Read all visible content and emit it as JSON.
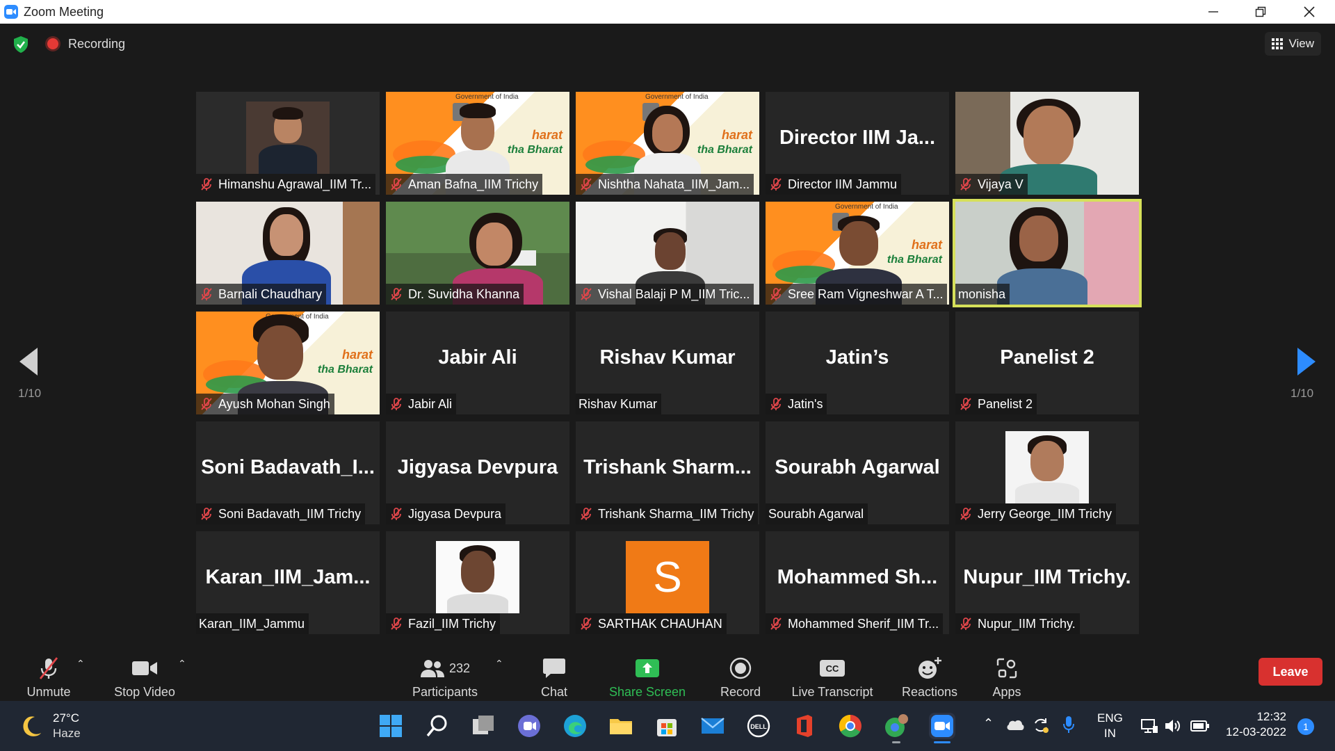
{
  "window": {
    "title": "Zoom Meeting"
  },
  "topbar": {
    "recording_label": "Recording",
    "view_label": "View"
  },
  "pagination": {
    "left": "1/10",
    "right": "1/10"
  },
  "tiles": [
    {
      "label": "Himanshu Agrawal_IIM Tr...",
      "big": "",
      "muted": true
    },
    {
      "label": "Aman Bafna_IIM Trichy",
      "big": "",
      "muted": true
    },
    {
      "label": "Nishtha Nahata_IIM_Jam...",
      "big": "",
      "muted": true
    },
    {
      "label": "Director IIM Jammu",
      "big": "Director  IIM  Ja...",
      "muted": true
    },
    {
      "label": "Vijaya V",
      "big": "",
      "muted": true
    },
    {
      "label": "Barnali Chaudhary",
      "big": "",
      "muted": true
    },
    {
      "label": "Dr. Suvidha Khanna",
      "big": "",
      "muted": true
    },
    {
      "label": "Vishal Balaji P M_IIM Tric...",
      "big": "",
      "muted": true
    },
    {
      "label": "Sree Ram Vigneshwar A T...",
      "big": "",
      "muted": true
    },
    {
      "label": "monisha",
      "big": "",
      "muted": false
    },
    {
      "label": "Ayush Mohan Singh",
      "big": "",
      "muted": true
    },
    {
      "label": "Jabir Ali",
      "big": "Jabir Ali",
      "muted": true
    },
    {
      "label": "Rishav Kumar",
      "big": "Rishav Kumar",
      "muted": false
    },
    {
      "label": "Jatin's",
      "big": "Jatin’s",
      "muted": true
    },
    {
      "label": "Panelist 2",
      "big": "Panelist 2",
      "muted": true
    },
    {
      "label": "Soni Badavath_IIM Trichy",
      "big": "Soni  Badavath_I...",
      "muted": true
    },
    {
      "label": "Jigyasa Devpura",
      "big": "Jigyasa Devpura",
      "muted": true
    },
    {
      "label": "Trishank Sharma_IIM Trichy",
      "big": "Trishank  Sharm...",
      "muted": true
    },
    {
      "label": "Sourabh Agarwal",
      "big": "Sourabh Agarwal",
      "muted": false
    },
    {
      "label": "Jerry George_IIM Trichy",
      "big": "",
      "muted": true
    },
    {
      "label": "Karan_IIM_Jammu",
      "big": "Karan_IIM_Jam...",
      "muted": false
    },
    {
      "label": "Fazil_IIM Trichy",
      "big": "",
      "muted": true
    },
    {
      "label": "SARTHAK CHAUHAN",
      "big": "",
      "muted": true
    },
    {
      "label": "Mohammed Sherif_IIM Tr...",
      "big": "Mohammed  Sh...",
      "muted": true
    },
    {
      "label": "Nupur_IIM Trichy.",
      "big": "Nupur_IIM Trichy.",
      "muted": true
    }
  ],
  "banner": {
    "gov": "Government of India",
    "line1": "harat",
    "line2": "tha Bharat"
  },
  "avatar_letter": "S",
  "toolbar": {
    "unmute": "Unmute",
    "stop_video": "Stop Video",
    "participants_count": "232",
    "participants": "Participants",
    "chat": "Chat",
    "share_screen": "Share Screen",
    "record": "Record",
    "live_transcript": "Live Transcript",
    "cc": "CC",
    "reactions": "Reactions",
    "apps": "Apps",
    "leave": "Leave"
  },
  "taskbar": {
    "temp": "27°C",
    "condition": "Haze",
    "lang1": "ENG",
    "lang2": "IN",
    "time": "12:32",
    "date": "12-03-2022",
    "notifications": "1"
  },
  "colors": {
    "accent": "#2d8cff",
    "leave": "#d8312f",
    "share": "#2fbe55",
    "active_speaker": "#d6e05a"
  }
}
